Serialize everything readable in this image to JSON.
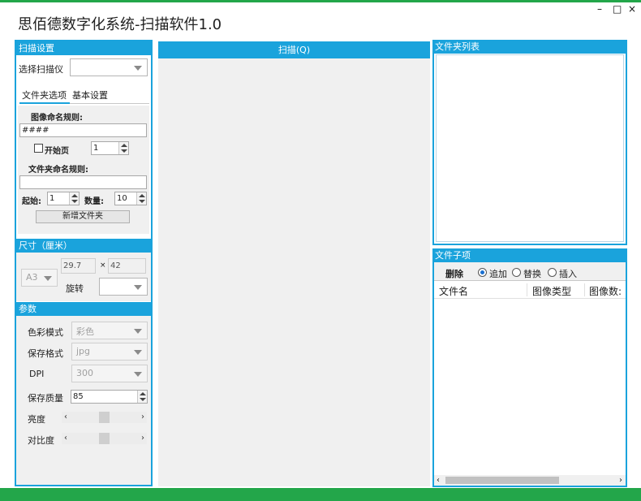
{
  "window": {
    "title": "思佰德数字化系统-扫描软件1.0",
    "minimize": "–",
    "maximize": "□",
    "close": "×"
  },
  "scan_settings": {
    "header": "扫描设置",
    "scanner_label": "选择扫描仪",
    "scanner_value": "",
    "tabs": [
      "文件夹选项",
      "基本设置"
    ],
    "image_naming_label": "图像命名规则:",
    "image_naming_value": "####",
    "start_page_label": "开始页",
    "start_page_value": "1",
    "folder_naming_label": "文件夹命名规则:",
    "folder_naming_value": "",
    "start_label": "起始:",
    "start_value": "1",
    "count_label": "数量:",
    "count_value": "10",
    "add_folder_button": "新增文件夹"
  },
  "size": {
    "header": "尺寸（厘米）",
    "paper": "A3",
    "width": "29.7",
    "times": "×",
    "height": "42",
    "rotate_label": "旋转",
    "rotate_value": ""
  },
  "params": {
    "header": "参数",
    "color_mode_label": "色彩模式",
    "color_mode_value": "彩色",
    "format_label": "保存格式",
    "format_value": "jpg",
    "dpi_label": "DPI",
    "dpi_value": "300",
    "quality_label": "保存质量",
    "quality_value": "85",
    "brightness_label": "亮度",
    "brightness_level": 0.5,
    "contrast_label": "对比度",
    "contrast_level": 0.5
  },
  "scan": {
    "button_label": "扫描(Q)"
  },
  "folder_list": {
    "header": "文件夹列表"
  },
  "file_items": {
    "header": "文件子项",
    "delete_button": "删除",
    "modes": [
      "追加",
      "替换",
      "插入"
    ],
    "selected_mode": "追加",
    "columns": [
      "文件名",
      "图像类型",
      "图像数:"
    ],
    "rows": []
  },
  "colors": {
    "accent": "#1aa3dc",
    "status_bar": "#23a64a"
  }
}
